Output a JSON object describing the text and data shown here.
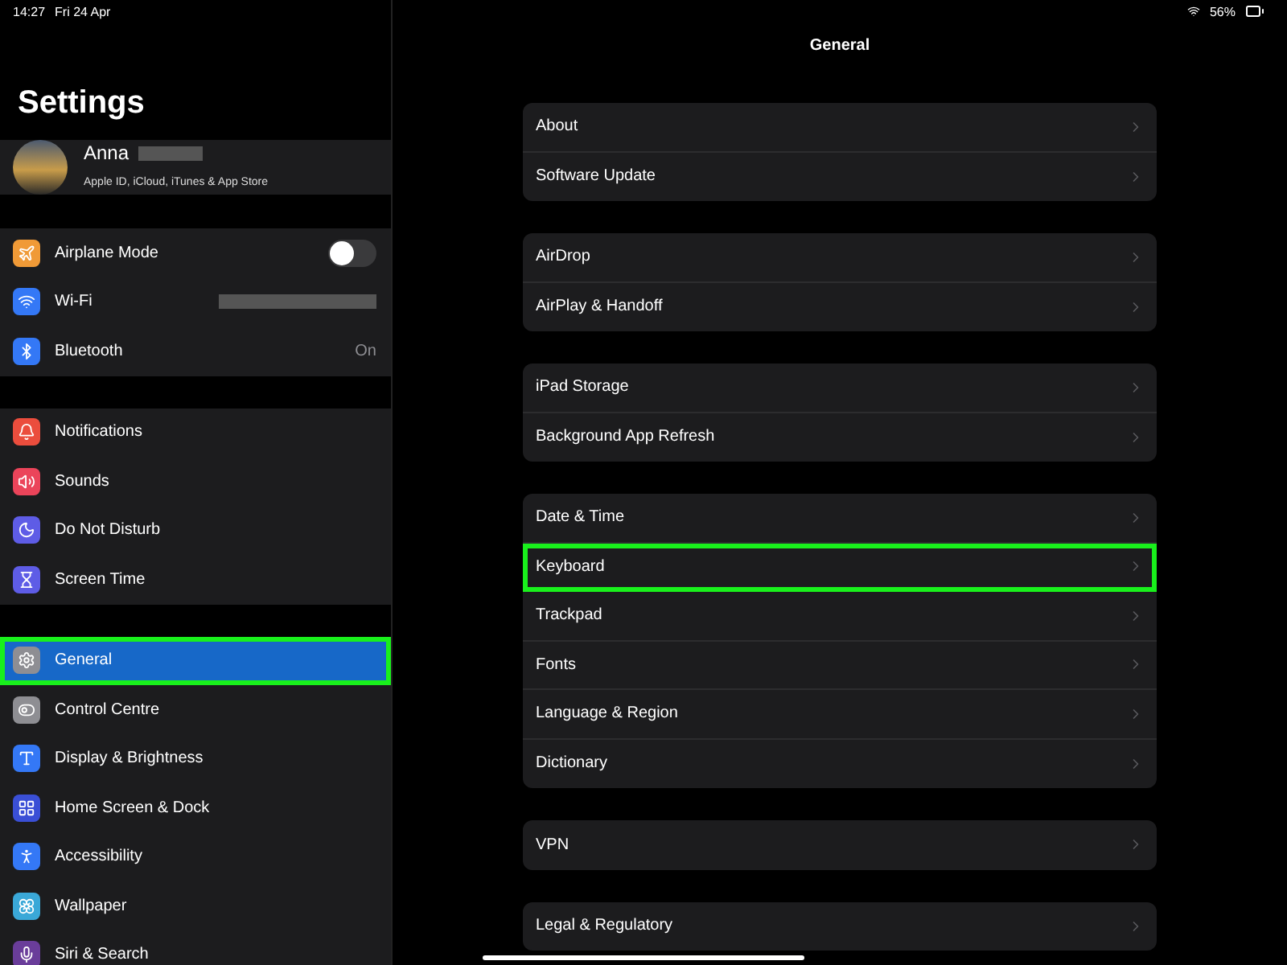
{
  "status_bar": {
    "time": "14:27",
    "date": "Fri 24 Apr",
    "battery": "56%"
  },
  "sidebar": {
    "title": "Settings",
    "profile": {
      "name": "Anna",
      "subtitle": "Apple ID, iCloud, iTunes & App Store"
    },
    "groups": [
      [
        {
          "label": "Airplane Mode",
          "kind": "toggle",
          "on": false,
          "selected": false,
          "highlighted": false,
          "color": "#f09a37"
        },
        {
          "label": "Wi-Fi",
          "kind": "redacted",
          "selected": false,
          "highlighted": false,
          "color": "#3478f6"
        },
        {
          "label": "Bluetooth",
          "kind": "value",
          "value": "On",
          "selected": false,
          "highlighted": false,
          "color": "#3478f6"
        }
      ],
      [
        {
          "label": "Notifications",
          "kind": "plain",
          "selected": false,
          "highlighted": false,
          "color": "#eb4d3d"
        },
        {
          "label": "Sounds",
          "kind": "plain",
          "selected": false,
          "highlighted": false,
          "color": "#eb445a"
        },
        {
          "label": "Do Not Disturb",
          "kind": "plain",
          "selected": false,
          "highlighted": false,
          "color": "#5e5ce6"
        },
        {
          "label": "Screen Time",
          "kind": "plain",
          "selected": false,
          "highlighted": false,
          "color": "#5e5ce6"
        }
      ],
      [
        {
          "label": "General",
          "kind": "plain",
          "selected": true,
          "highlighted": true,
          "color": "#8e8e93"
        },
        {
          "label": "Control Centre",
          "kind": "plain",
          "selected": false,
          "highlighted": false,
          "color": "#8e8e93"
        },
        {
          "label": "Display & Brightness",
          "kind": "plain",
          "selected": false,
          "highlighted": false,
          "color": "#3478f6"
        },
        {
          "label": "Home Screen & Dock",
          "kind": "plain",
          "selected": false,
          "highlighted": false,
          "color": "#3a4fd6"
        },
        {
          "label": "Accessibility",
          "kind": "plain",
          "selected": false,
          "highlighted": false,
          "color": "#3478f6"
        },
        {
          "label": "Wallpaper",
          "kind": "plain",
          "selected": false,
          "highlighted": false,
          "color": "#3aa8d8"
        },
        {
          "label": "Siri & Search",
          "kind": "plain",
          "selected": false,
          "highlighted": false,
          "color": "#6a3d9a"
        }
      ]
    ]
  },
  "detail": {
    "title": "General",
    "groups": [
      [
        {
          "label": "About",
          "highlighted": false
        },
        {
          "label": "Software Update",
          "highlighted": false
        }
      ],
      [
        {
          "label": "AirDrop",
          "highlighted": false
        },
        {
          "label": "AirPlay & Handoff",
          "highlighted": false
        }
      ],
      [
        {
          "label": "iPad Storage",
          "highlighted": false
        },
        {
          "label": "Background App Refresh",
          "highlighted": false
        }
      ],
      [
        {
          "label": "Date & Time",
          "highlighted": false
        },
        {
          "label": "Keyboard",
          "highlighted": true
        },
        {
          "label": "Trackpad",
          "highlighted": false
        },
        {
          "label": "Fonts",
          "highlighted": false
        },
        {
          "label": "Language & Region",
          "highlighted": false
        },
        {
          "label": "Dictionary",
          "highlighted": false
        }
      ],
      [
        {
          "label": "VPN",
          "highlighted": false
        }
      ],
      [
        {
          "label": "Legal & Regulatory",
          "highlighted": false
        }
      ]
    ]
  }
}
